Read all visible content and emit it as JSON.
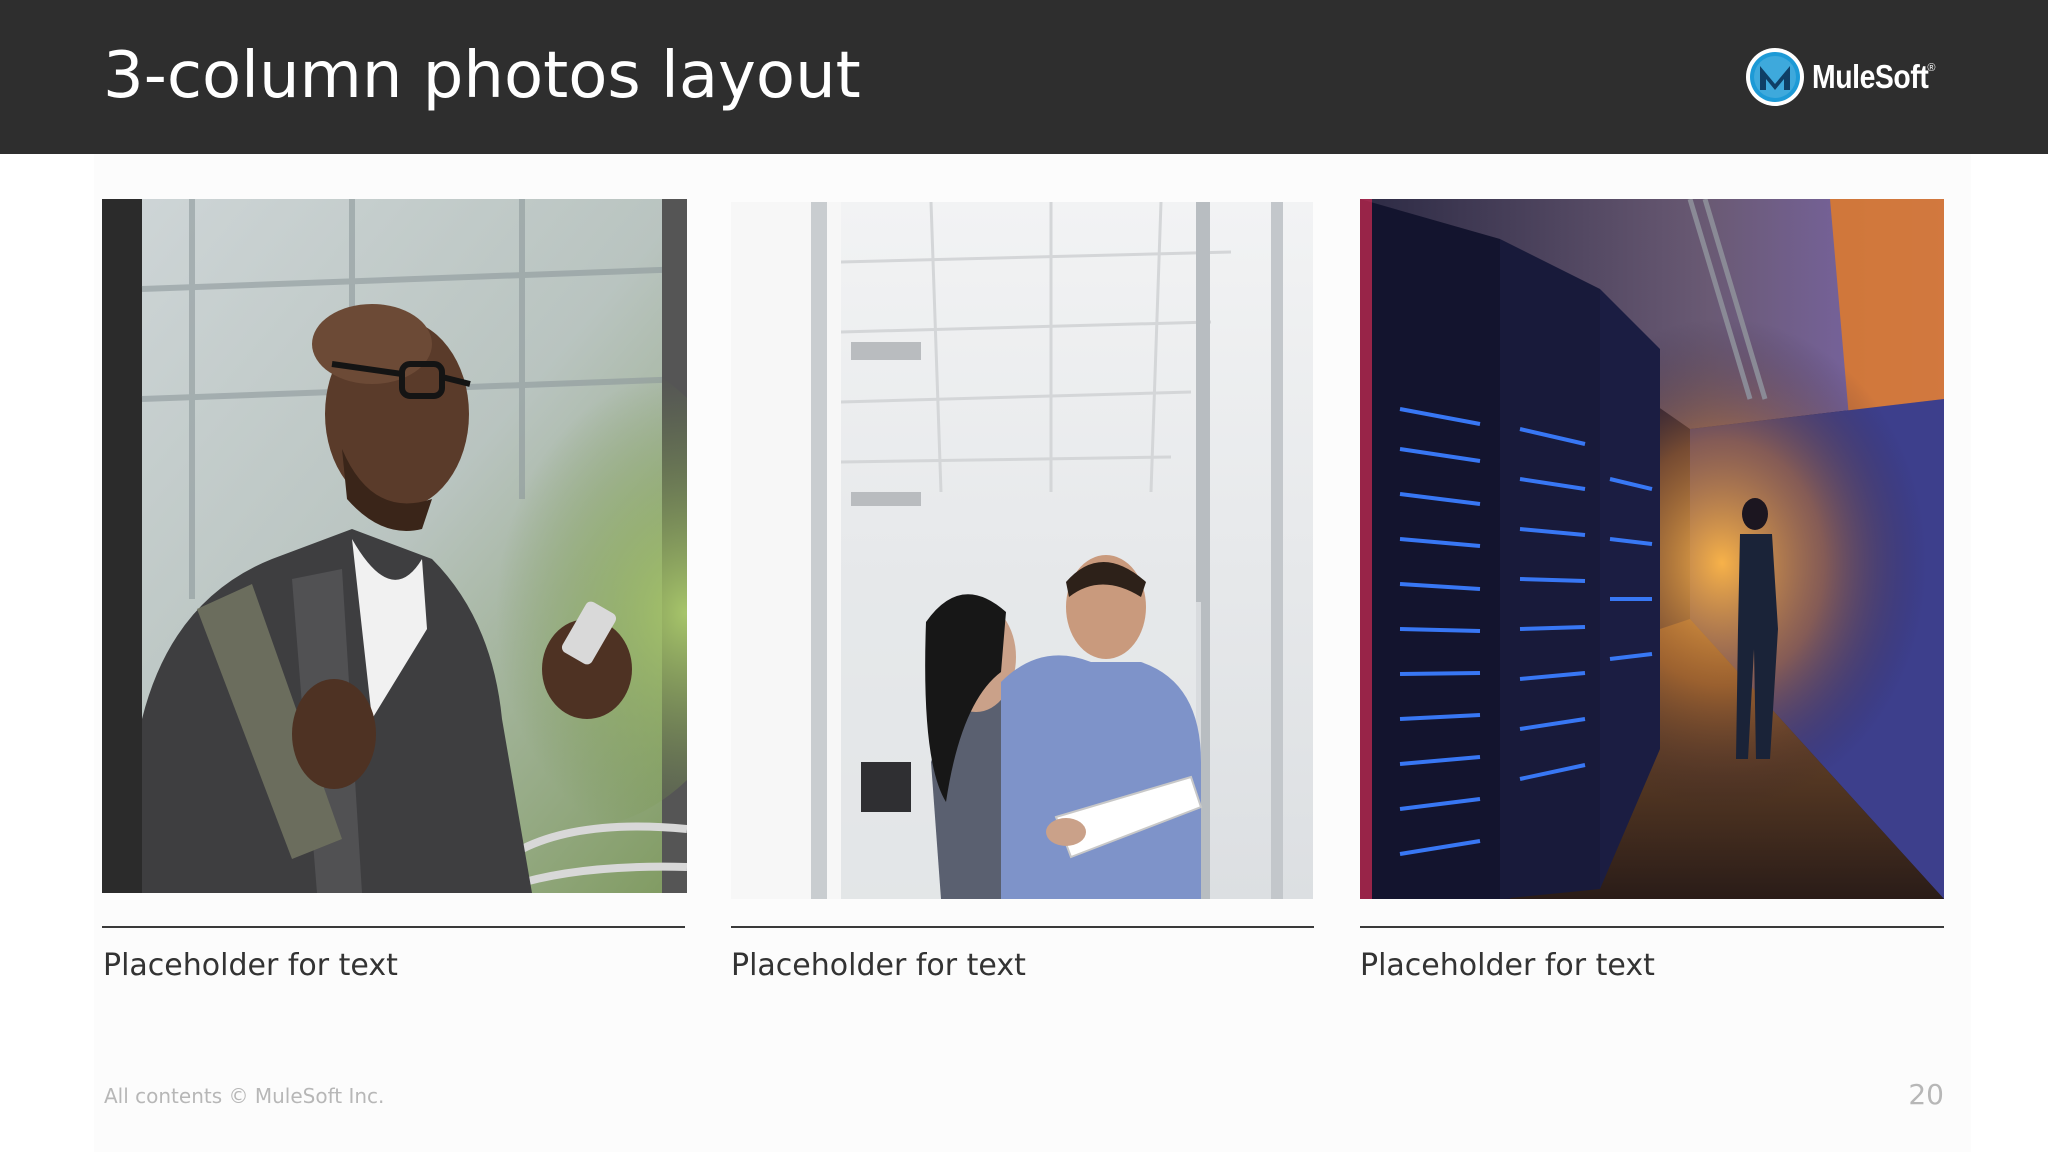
{
  "slide": {
    "title": "3-column photos layout",
    "brand": "MuleSoft",
    "brand_mark": "®",
    "columns": [
      {
        "image": "man-with-phone-photo",
        "caption": "Placeholder for text"
      },
      {
        "image": "office-colleagues-photo",
        "caption": "Placeholder for text"
      },
      {
        "image": "server-room-photo",
        "caption": "Placeholder for text"
      }
    ],
    "footer": "All contents © MuleSoft Inc.",
    "page_number": "20"
  },
  "colors": {
    "header_bg": "#2e2e2e",
    "logo_blue": "#1d9ad6",
    "rule": "#3a3a3a"
  }
}
